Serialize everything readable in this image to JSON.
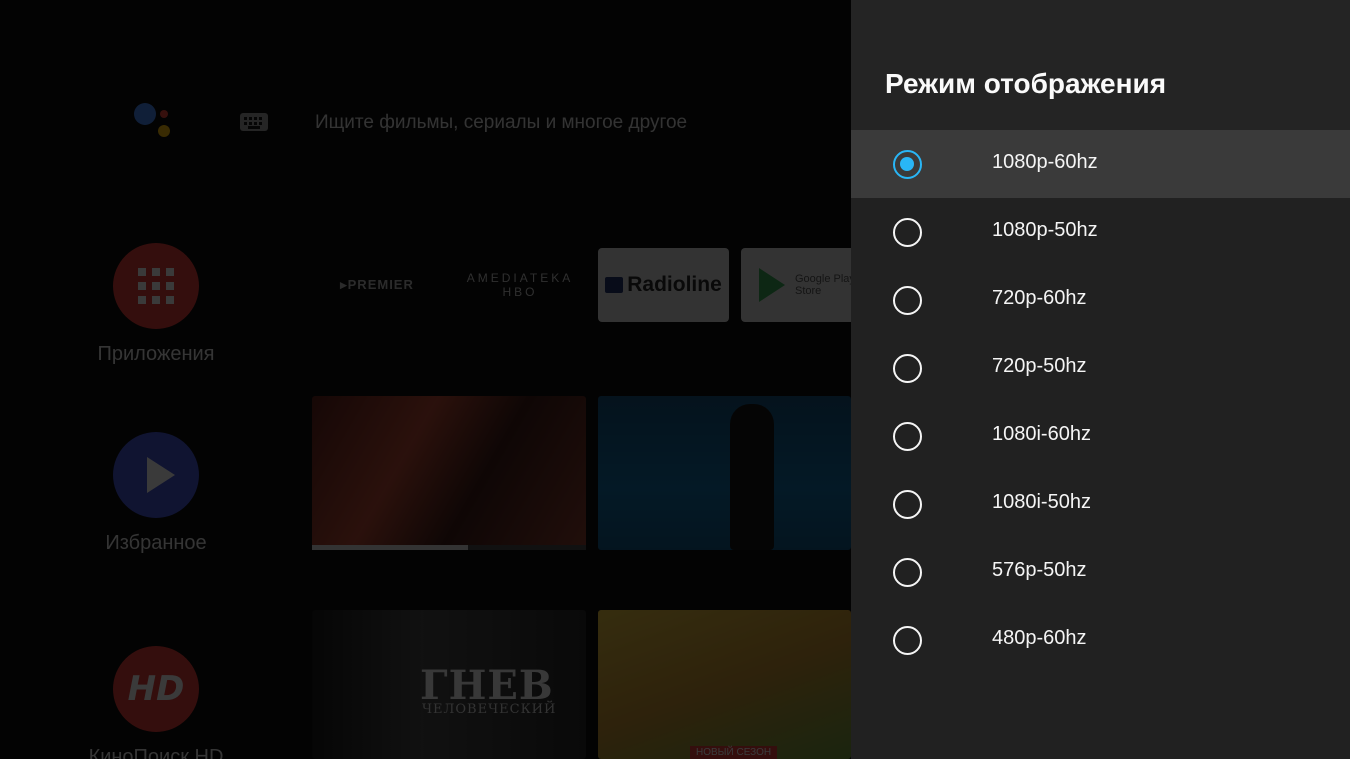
{
  "launcher": {
    "search_placeholder": "Ищите фильмы, сериалы и многое другое",
    "side_items": [
      {
        "label": "Приложения",
        "icon": "apps-grid-icon"
      },
      {
        "label": "Избранное",
        "icon": "play-icon"
      },
      {
        "label": "КиноПоиск HD",
        "icon": "kinopoisk-hd-icon",
        "icon_text": "HD"
      }
    ],
    "channels": {
      "premier": "▸PREMIER",
      "amediateka": "AMEDIATEKA",
      "amediateka_sub": "HBO",
      "radioline": "Radioline",
      "play_store": "Google Play Store"
    },
    "thumbnails": {
      "movie_title": "ГНЕВ",
      "movie_subtitle": "ЧЕЛОВЕЧЕСКИЙ",
      "new_season_badge": "НОВЫЙ СЕЗОН",
      "watch_progress": 0.57
    }
  },
  "panel": {
    "title": "Режим отображения",
    "options": [
      {
        "label": "1080p-60hz",
        "selected": true
      },
      {
        "label": "1080p-50hz",
        "selected": false
      },
      {
        "label": "720p-60hz",
        "selected": false
      },
      {
        "label": "720p-50hz",
        "selected": false
      },
      {
        "label": "1080i-60hz",
        "selected": false
      },
      {
        "label": "1080i-50hz",
        "selected": false
      },
      {
        "label": "576p-50hz",
        "selected": false
      },
      {
        "label": "480p-60hz",
        "selected": false
      }
    ],
    "accent_color": "#29b6f6"
  }
}
